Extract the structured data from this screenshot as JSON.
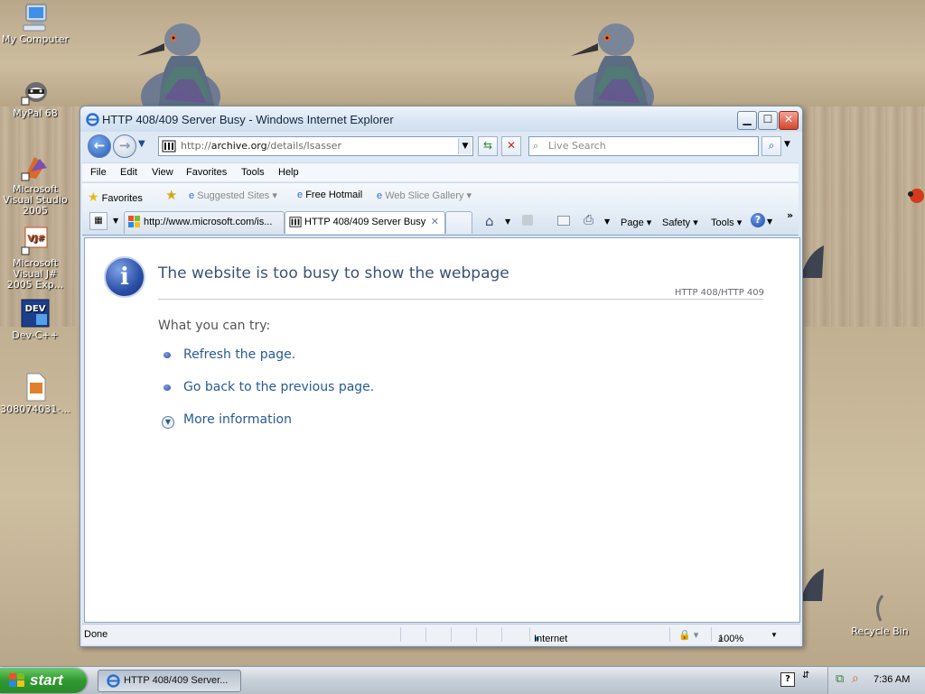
{
  "desktop": {
    "icons": [
      {
        "label": "My Computer"
      },
      {
        "label": "MyPal 68"
      },
      {
        "label": "Microsoft Visual Studio 2005"
      },
      {
        "label": "Microsoft Visual J# 2005 Exp..."
      },
      {
        "label": "Dev-C++"
      },
      {
        "label": "308074031-..."
      },
      {
        "label": "Recycle Bin"
      }
    ]
  },
  "window": {
    "title": "HTTP 408/409 Server Busy - Windows Internet Explorer",
    "address": {
      "prefix": "http://",
      "domain": "archive.org",
      "path": "/details/lsasser"
    },
    "search_placeholder": "Live Search",
    "menu": [
      "File",
      "Edit",
      "View",
      "Favorites",
      "Tools",
      "Help"
    ],
    "favorites_bar": {
      "favorites_label": "Favorites",
      "items": [
        "Suggested Sites",
        "Free Hotmail",
        "Web Slice Gallery"
      ]
    },
    "tabs": [
      {
        "label": "http://www.microsoft.com/is...",
        "active": false
      },
      {
        "label": "HTTP 408/409 Server Busy",
        "active": true
      }
    ],
    "commands": [
      "Page",
      "Safety",
      "Tools"
    ],
    "page": {
      "heading": "The website is too busy to show the webpage",
      "code": "HTTP 408/HTTP 409",
      "try_label": "What you can try:",
      "links": [
        "Refresh the page.",
        "Go back to the previous page."
      ],
      "more_info": "More information"
    },
    "status": {
      "text": "Done",
      "zone": "Internet",
      "zoom": "100%"
    }
  },
  "taskbar": {
    "start_label": "start",
    "task_label": "HTTP 408/409 Server...",
    "time": "7:36 AM"
  },
  "colors": {
    "link": "#2a5a94",
    "heading": "#3a5276",
    "start_green": "#2f9a2f"
  }
}
